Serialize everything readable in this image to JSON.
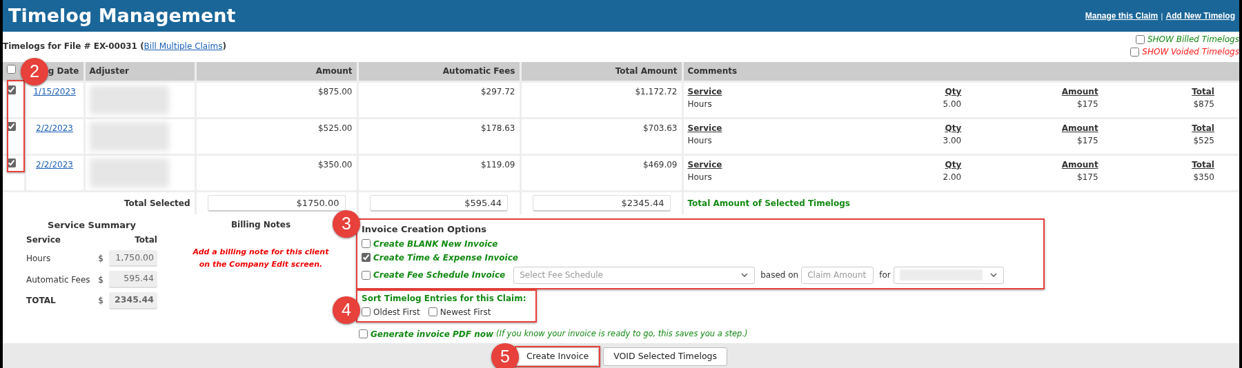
{
  "header": {
    "title": "Timelog Management",
    "links": [
      "Manage this Claim",
      "Add New Timelog"
    ],
    "separator": "|"
  },
  "file_line": {
    "label": "Timelogs for File # EX-00031",
    "open": "(",
    "link": "Bill Multiple Claims",
    "close": ")"
  },
  "filters": [
    {
      "label": "SHOW Billed Timelogs",
      "checked": false,
      "color": "#138a13"
    },
    {
      "label": "SHOW Voided Timelogs",
      "checked": false,
      "color": "#ff1a1a"
    }
  ],
  "table": {
    "select_all_checked": false,
    "columns": [
      "g Date",
      "Adjuster",
      "Amount",
      "Automatic Fees",
      "Total Amount",
      "Comments"
    ],
    "rows": [
      {
        "checked": true,
        "date": "1/15/2023",
        "amount": "$875.00",
        "fees": "$297.72",
        "total": "$1,172.72",
        "comment_headers": [
          "Service",
          "Qty",
          "Amount",
          "Total"
        ],
        "comment_values": [
          "Hours",
          "5.00",
          "$175",
          "$875"
        ]
      },
      {
        "checked": true,
        "date": "2/2/2023",
        "amount": "$525.00",
        "fees": "$178.63",
        "total": "$703.63",
        "comment_headers": [
          "Service",
          "Qty",
          "Amount",
          "Total"
        ],
        "comment_values": [
          "Hours",
          "3.00",
          "$175",
          "$525"
        ]
      },
      {
        "checked": true,
        "date": "2/2/2023",
        "amount": "$350.00",
        "fees": "$119.09",
        "total": "$469.09",
        "comment_headers": [
          "Service",
          "Qty",
          "Amount",
          "Total"
        ],
        "comment_values": [
          "Hours",
          "2.00",
          "$175",
          "$350"
        ]
      }
    ],
    "totals": {
      "label": "Total Selected",
      "amount": "$1750.00",
      "fees": "$595.44",
      "total": "$2345.44",
      "note": "Total Amount of Selected Timelogs"
    }
  },
  "summary": {
    "title": "Service Summary",
    "headers": [
      "Service",
      "Total"
    ],
    "rows": [
      {
        "label": "Hours",
        "currency": "$",
        "value": "1,750.00",
        "kind": "line"
      },
      {
        "label": "Automatic Fees",
        "currency": "$",
        "value": "595.44",
        "kind": "line"
      },
      {
        "label": "TOTAL",
        "currency": "$",
        "value": "2345.44",
        "kind": "total"
      }
    ]
  },
  "billing": {
    "title": "Billing Notes",
    "note": "Add a billing note for this client on the Company Edit screen."
  },
  "invoice_options": {
    "title": "Invoice Creation Options",
    "options": [
      {
        "label": "Create BLANK New Invoice",
        "checked": false,
        "kind": "plain"
      },
      {
        "label": "Create Time & Expense Invoice",
        "checked": true,
        "kind": "plain"
      },
      {
        "label": "Create Fee Schedule Invoice",
        "checked": false,
        "kind": "fee"
      }
    ],
    "fee_placeholder": "Select Fee Schedule",
    "based_on": "based on",
    "basis": "Claim Amount",
    "for_label": "for"
  },
  "sort": {
    "title": "Sort Timelog Entries for this Claim:",
    "options": [
      {
        "label": "Oldest First",
        "checked": false
      },
      {
        "label": "Newest First",
        "checked": false
      }
    ]
  },
  "pdf": {
    "label": "Generate invoice PDF now",
    "checked": false,
    "note": "(If you know your invoice is ready to go, this saves you a step.)"
  },
  "buttons": [
    "Create Invoice",
    "VOID Selected Timelogs"
  ],
  "callouts": [
    {
      "number": "2"
    },
    {
      "number": "3"
    },
    {
      "number": "4"
    },
    {
      "number": "5"
    }
  ]
}
